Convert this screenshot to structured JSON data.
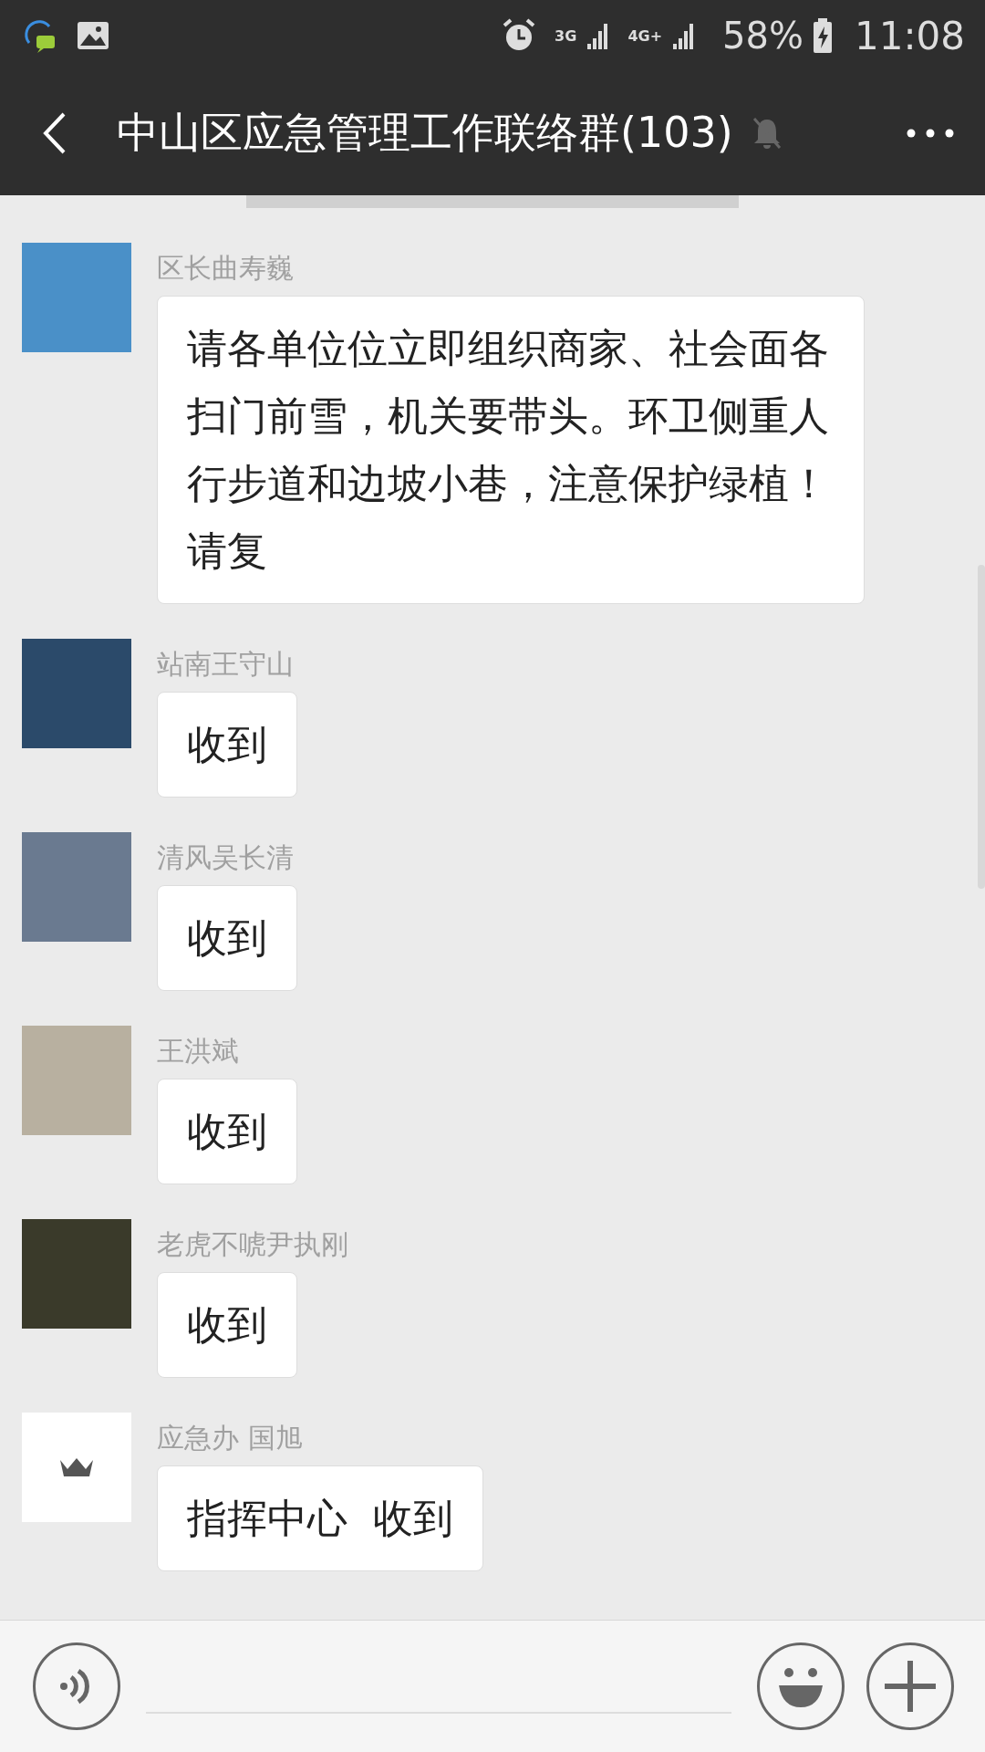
{
  "status_bar": {
    "network_1": "3G",
    "network_2": "4G+",
    "battery": "58%",
    "time": "11:08"
  },
  "header": {
    "title": "中山区应急管理工作联络群(103)",
    "muted": true
  },
  "messages": [
    {
      "sender": "区长曲寿巍",
      "kind": "photo",
      "text": "请各单位位立即组织商家、社会面各扫门前雪，机关要带头。环卫侧重人行步道和边坡小巷，注意保护绿植！请复"
    },
    {
      "sender": "站南王守山",
      "kind": "photo",
      "text": "收到"
    },
    {
      "sender": "清风吴长清",
      "kind": "photo",
      "text": "收到"
    },
    {
      "sender": "王洪斌",
      "kind": "photo",
      "text": "收到"
    },
    {
      "sender": "老虎不唬尹执刚",
      "kind": "photo",
      "text": "收到"
    },
    {
      "sender": "应急办 国旭",
      "kind": "crown",
      "text": "指挥中心  收到"
    }
  ]
}
